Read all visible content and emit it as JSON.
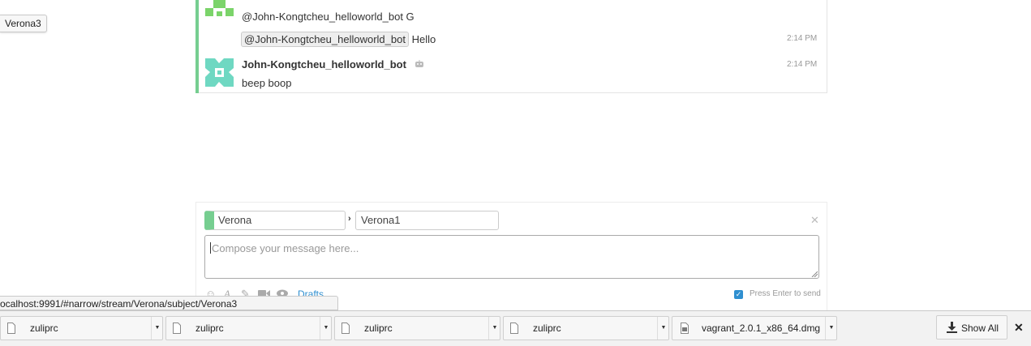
{
  "tooltip": {
    "text": "Verona3"
  },
  "messages": [
    {
      "sender": "",
      "body": "@John-Kongtcheu_helloworld_bot G",
      "time": ""
    },
    {
      "mention": "@John-Kongtcheu_helloworld_bot",
      "body": "Hello",
      "time": "2:14 PM"
    },
    {
      "sender": "John-Kongtcheu_helloworld_bot",
      "body": "beep boop",
      "time": "2:14 PM"
    }
  ],
  "compose": {
    "stream": "Verona",
    "topic": "Verona1",
    "placeholder": "Compose your message here...",
    "drafts_label": "Drafts",
    "enter_to_send_label": "Press Enter to send",
    "enter_to_send_checked": true
  },
  "status_url": "ocalhost:9991/#narrow/stream/Verona/subject/Verona3",
  "downloads": {
    "items": [
      {
        "name": "zuliprc"
      },
      {
        "name": "zuliprc"
      },
      {
        "name": "zuliprc"
      },
      {
        "name": "zuliprc"
      },
      {
        "name": "vagrant_2.0.1_x86_64.dmg"
      }
    ],
    "show_all_label": "Show All"
  },
  "colors": {
    "stream": "#76ce90",
    "link": "#2f8fd0"
  }
}
